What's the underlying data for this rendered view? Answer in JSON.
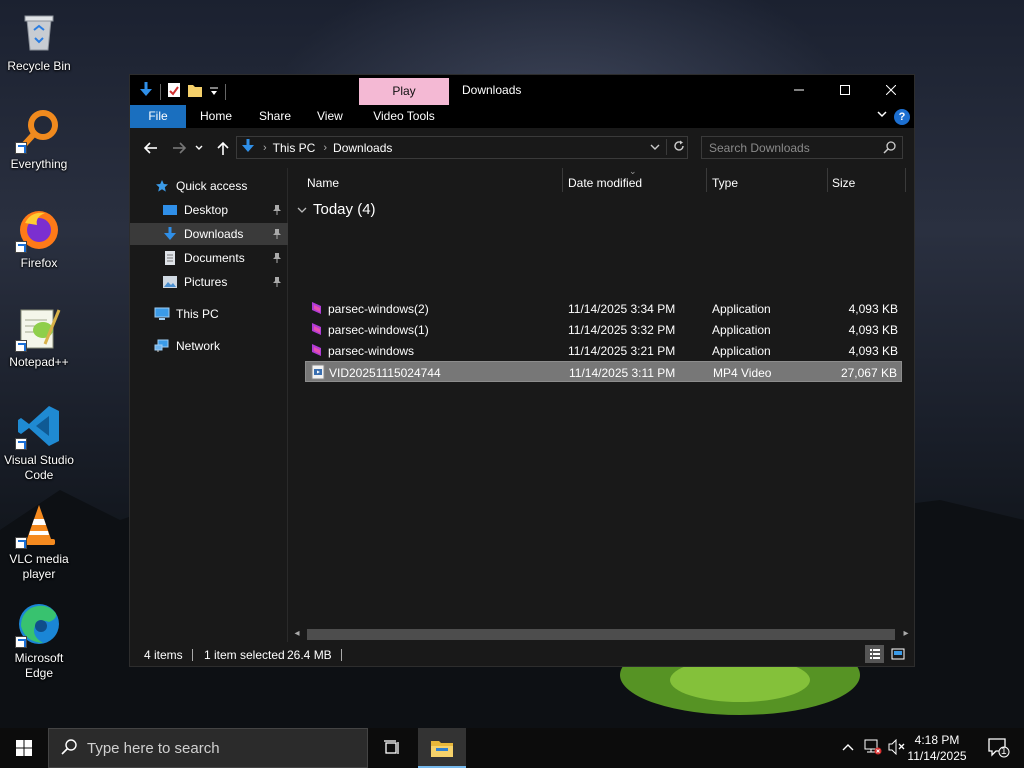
{
  "desktop": {
    "icons": [
      {
        "label": "Recycle Bin"
      },
      {
        "label": "Everything"
      },
      {
        "label": "Firefox"
      },
      {
        "label": "Notepad++"
      },
      {
        "label": "Visual Studio Code"
      },
      {
        "label": "VLC media player"
      },
      {
        "label": "Microsoft Edge"
      }
    ]
  },
  "window": {
    "title": "Downloads",
    "contextual_tab": "Play",
    "ribbon_tabs": [
      "File",
      "Home",
      "Share",
      "View",
      "Video Tools"
    ],
    "help_label": "?",
    "address": {
      "crumbs": [
        "This PC",
        "Downloads"
      ]
    },
    "search": {
      "placeholder": "Search Downloads"
    },
    "nav": {
      "quick_access": "Quick access",
      "items": [
        {
          "label": "Desktop",
          "pinned": true
        },
        {
          "label": "Downloads",
          "pinned": true,
          "selected": true
        },
        {
          "label": "Documents",
          "pinned": true
        },
        {
          "label": "Pictures",
          "pinned": true
        }
      ],
      "this_pc": "This PC",
      "network": "Network"
    },
    "columns": [
      "Name",
      "Date modified",
      "Type",
      "Size"
    ],
    "group": "Today (4)",
    "files": [
      {
        "name": "parsec-windows(2)",
        "date": "11/14/2025 3:34 PM",
        "type": "Application",
        "size": "4,093 KB",
        "icon": "parsec-icon"
      },
      {
        "name": "parsec-windows(1)",
        "date": "11/14/2025 3:32 PM",
        "type": "Application",
        "size": "4,093 KB",
        "icon": "parsec-icon"
      },
      {
        "name": "parsec-windows",
        "date": "11/14/2025 3:21 PM",
        "type": "Application",
        "size": "4,093 KB",
        "icon": "parsec-icon"
      },
      {
        "name": "VID20251115024744",
        "date": "11/14/2025 3:11 PM",
        "type": "MP4 Video",
        "size": "27,067 KB",
        "icon": "video-file-icon",
        "selected": true
      }
    ],
    "status": {
      "items": "4 items",
      "selected": "1 item selected",
      "size": "26.4 MB"
    }
  },
  "taskbar": {
    "search_placeholder": "Type here to search",
    "time": "4:18 PM",
    "date": "11/14/2025",
    "notification_count": "1"
  },
  "colors": {
    "file_tab": "#1a6fbf",
    "play_tab": "#f4b9d4",
    "selection": "#777777"
  }
}
